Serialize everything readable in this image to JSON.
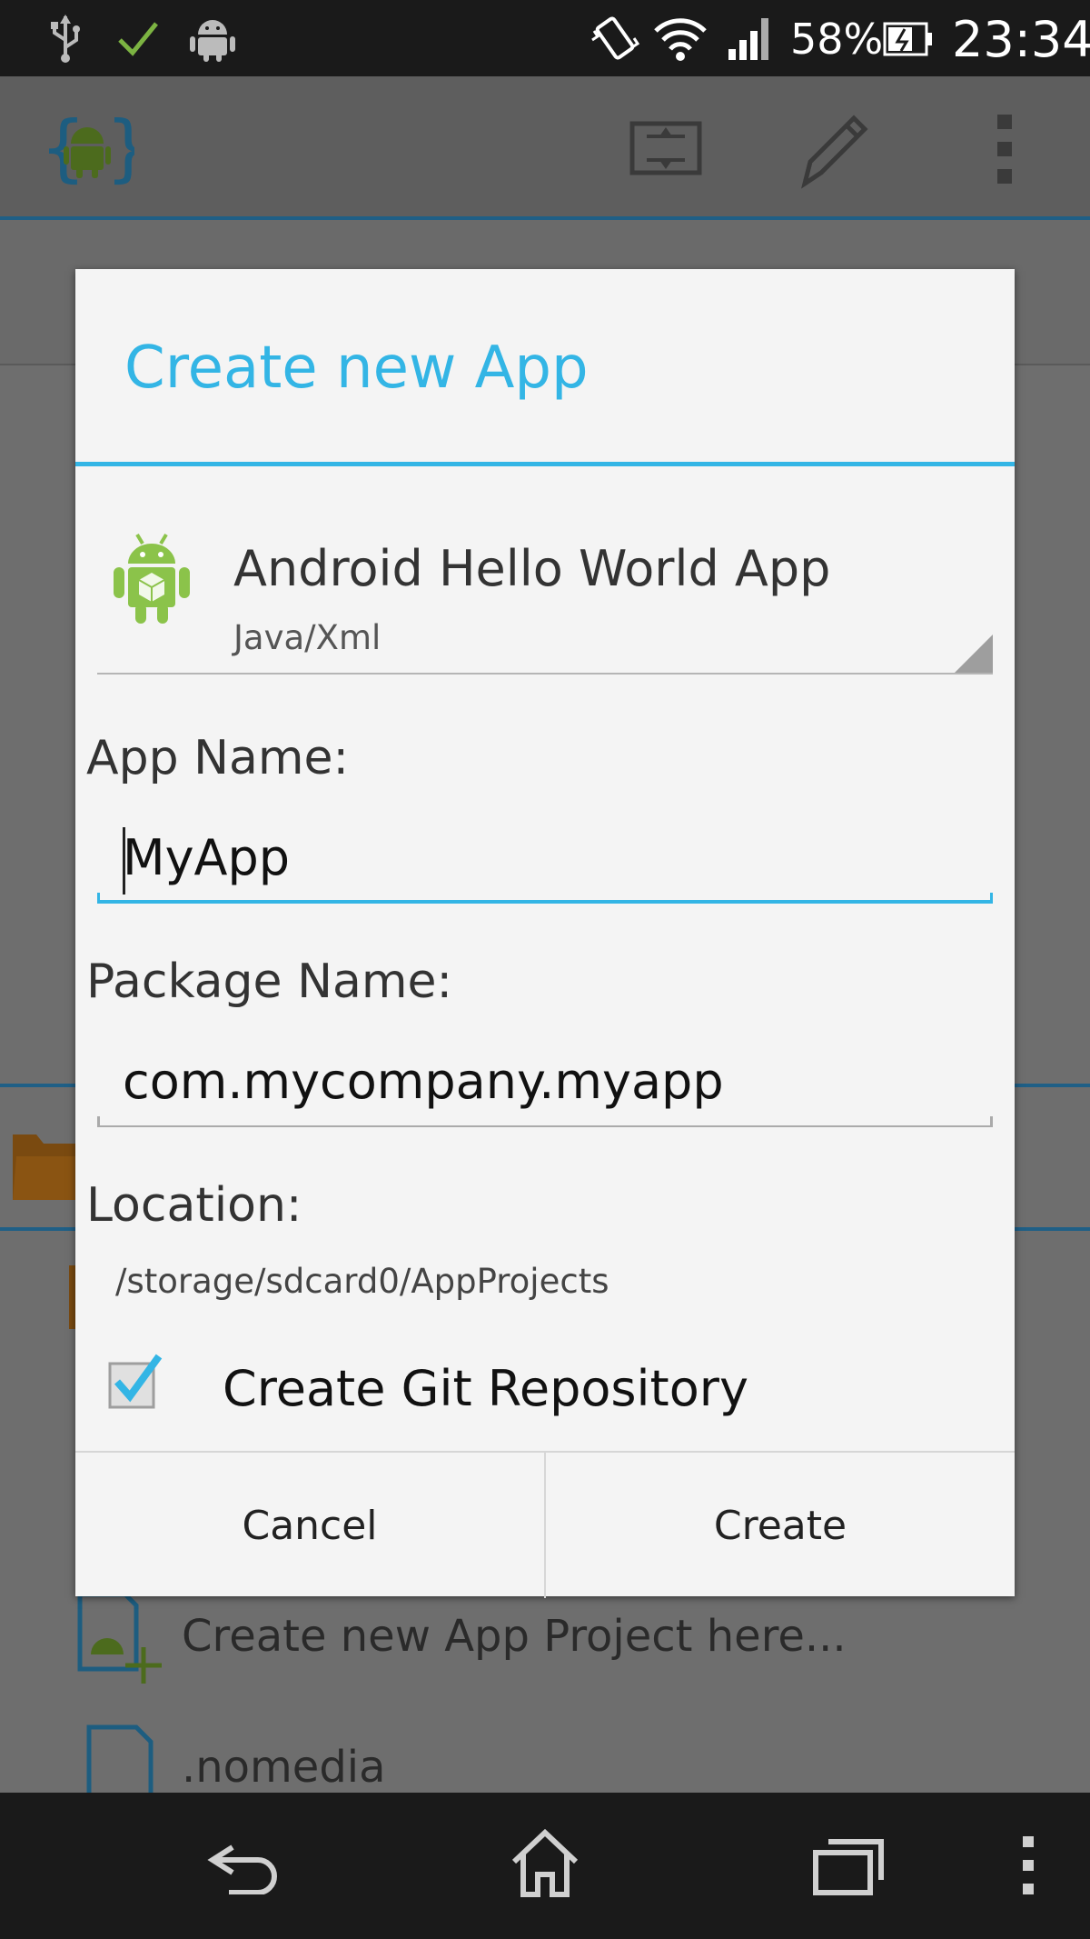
{
  "status_bar": {
    "battery_percent": "58%",
    "time": "23:34",
    "icons": [
      "usb-icon",
      "check-icon",
      "android-debug-icon",
      "vibrate-icon",
      "wifi-icon",
      "signal-icon",
      "battery-icon"
    ]
  },
  "background": {
    "list_items": [
      "Create new App Project here...",
      ".nomedia"
    ]
  },
  "dialog": {
    "title": "Create new App",
    "template": {
      "name": "Android Hello World App",
      "subtitle": "Java/Xml"
    },
    "app_name": {
      "label": "App Name:",
      "value": "MyApp"
    },
    "package_name": {
      "label": "Package Name:",
      "value": "com.mycompany.myapp"
    },
    "location": {
      "label": "Location:",
      "value": "/storage/sdcard0/AppProjects"
    },
    "git": {
      "label": "Create Git Repository",
      "checked": true
    },
    "buttons": {
      "cancel": "Cancel",
      "create": "Create"
    }
  },
  "colors": {
    "accent": "#33b5e5",
    "android_green": "#a4c639",
    "folder_orange": "#c67a1e"
  }
}
